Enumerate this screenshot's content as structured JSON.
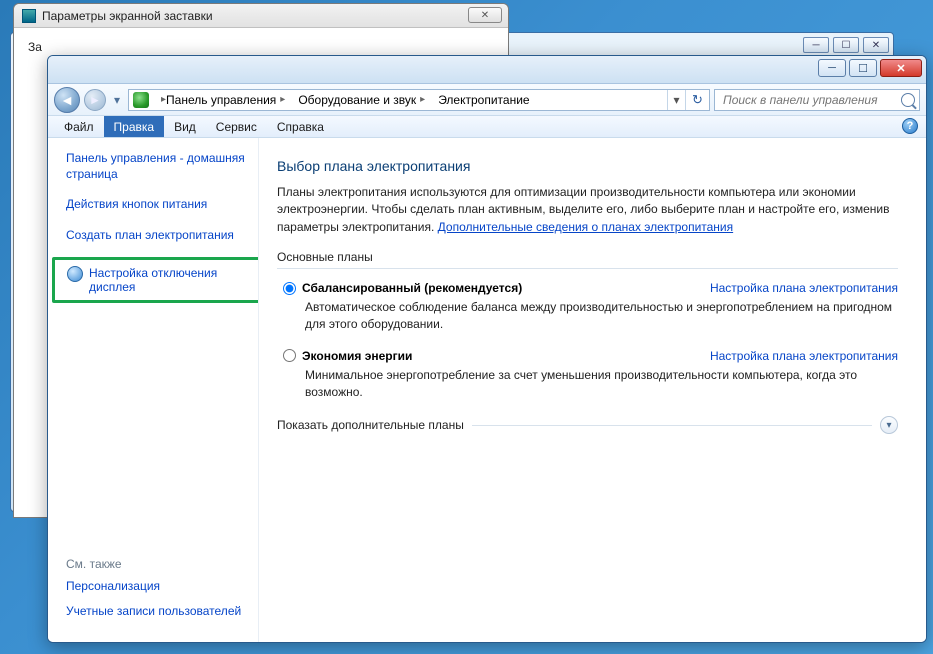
{
  "bg_dialog": {
    "title": "Параметры экранной заставки",
    "close_glyph": "✕",
    "body_fragment": "За"
  },
  "bg_parent_buttons": {
    "min": "─",
    "max": "☐",
    "close": "✕"
  },
  "titlebar": {
    "min": "─",
    "max": "☐",
    "close": "✕"
  },
  "address": {
    "seg1": "Панель управления",
    "seg2": "Оборудование и звук",
    "seg3": "Электропитание",
    "refresh_glyph": "↻"
  },
  "search": {
    "placeholder": "Поиск в панели управления"
  },
  "menu": {
    "file": "Файл",
    "edit": "Правка",
    "view": "Вид",
    "service": "Сервис",
    "help": "Справка",
    "q": "?"
  },
  "sidebar": {
    "home": "Панель управления - домашняя страница",
    "buttons": "Действия кнопок питания",
    "create": "Создать план электропитания",
    "display_off": "Настройка отключения дисплея",
    "see_also": "См. также",
    "personalization": "Персонализация",
    "accounts": "Учетные записи пользователей"
  },
  "content": {
    "heading": "Выбор плана электропитания",
    "intro_a": "Планы электропитания используются для оптимизации производительности компьютера или экономии электроэнергии. Чтобы сделать план активным, выделите его, либо выберите план и настройте его, изменив параметры электропитания. ",
    "intro_link": "Дополнительные сведения о планах электропитания",
    "section_label": "Основные планы",
    "plan1": {
      "title": "Сбалансированный (рекомендуется)",
      "config": "Настройка плана электропитания",
      "desc": "Автоматическое соблюдение баланса между производительностью и энергопотреблением на пригодном для этого оборудовании."
    },
    "plan2": {
      "title": "Экономия энергии",
      "config": "Настройка плана электропитания",
      "desc": "Минимальное энергопотребление за счет уменьшения производительности компьютера, когда это возможно."
    },
    "expand": "Показать дополнительные планы"
  }
}
